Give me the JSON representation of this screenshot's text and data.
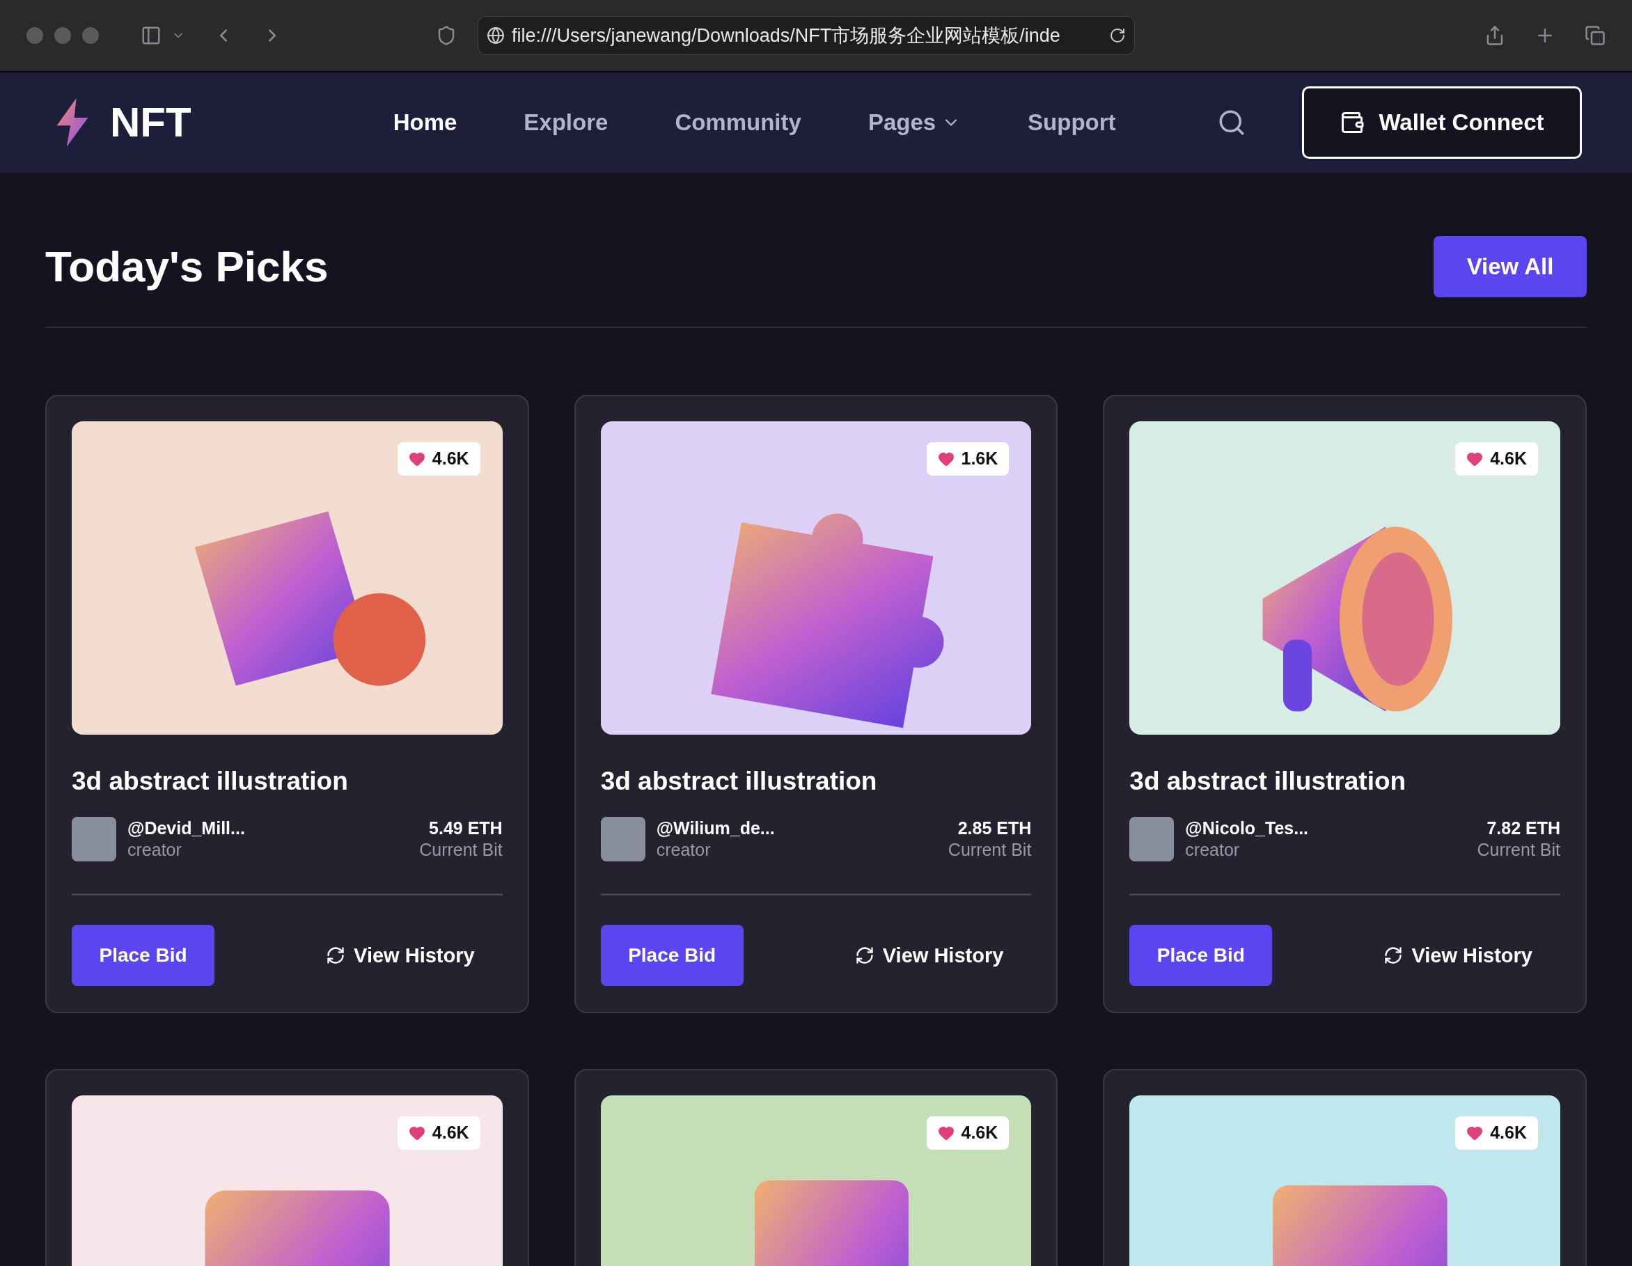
{
  "browser": {
    "url": "file:///Users/janewang/Downloads/NFT市场服务企业网站模板/inde"
  },
  "nav": {
    "logo": "NFT",
    "items": [
      {
        "label": "Home",
        "selected": true,
        "dropdown": false
      },
      {
        "label": "Explore",
        "selected": false,
        "dropdown": false
      },
      {
        "label": "Community",
        "selected": false,
        "dropdown": false
      },
      {
        "label": "Pages",
        "selected": false,
        "dropdown": true
      },
      {
        "label": "Support",
        "selected": false,
        "dropdown": false
      }
    ],
    "wallet_button": "Wallet Connect"
  },
  "section": {
    "title": "Today's Picks",
    "view_all": "View All"
  },
  "cards": [
    {
      "likes": "4.6K",
      "title": "3d abstract illustration",
      "creator": "@Devid_Mill...",
      "role": "creator",
      "price": "5.49 ETH",
      "price_label": "Current Bit",
      "bid": "Place Bid",
      "history": "View History"
    },
    {
      "likes": "1.6K",
      "title": "3d abstract illustration",
      "creator": "@Wilium_de...",
      "role": "creator",
      "price": "2.85 ETH",
      "price_label": "Current Bit",
      "bid": "Place Bid",
      "history": "View History"
    },
    {
      "likes": "4.6K",
      "title": "3d abstract illustration",
      "creator": "@Nicolo_Tes...",
      "role": "creator",
      "price": "7.82 ETH",
      "price_label": "Current Bit",
      "bid": "Place Bid",
      "history": "View History"
    },
    {
      "likes": "4.6K"
    },
    {
      "likes": "4.6K"
    },
    {
      "likes": "4.6K"
    }
  ]
}
